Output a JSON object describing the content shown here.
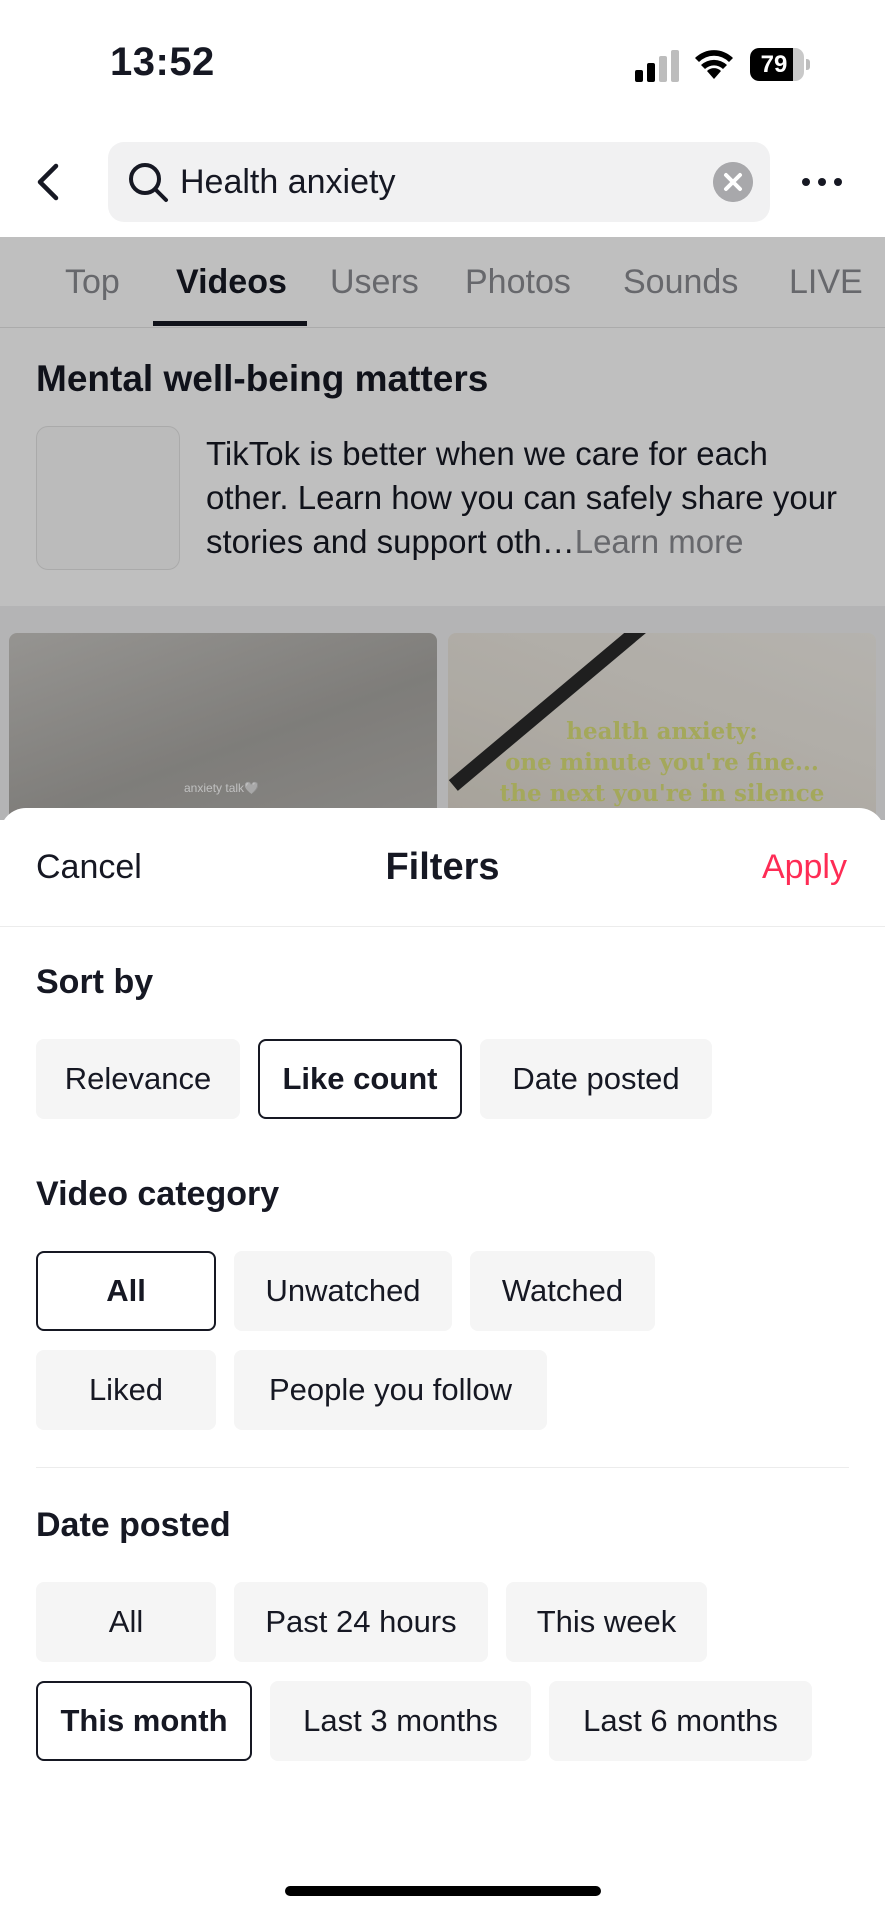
{
  "status_bar": {
    "time": "13:52",
    "battery": "79",
    "battery_level": 0.79
  },
  "search": {
    "query": "Health anxiety"
  },
  "tabs": [
    "Top",
    "Videos",
    "Users",
    "Photos",
    "Sounds",
    "LIVE"
  ],
  "wellbeing": {
    "title": "Mental well-being matters",
    "text": "TikTok is better when we care for each other. Learn how you can safely share your stories and support oth…",
    "link": "Learn more"
  },
  "videos": [
    {
      "caption": "anxiety talk🤍"
    },
    {
      "caption_lines": [
        "health anxiety:",
        "one minute you're fine...",
        "the next you're in silence"
      ]
    }
  ],
  "filters": {
    "cancel_label": "Cancel",
    "title": "Filters",
    "apply_label": "Apply",
    "sort_by": {
      "title": "Sort by",
      "options": [
        "Relevance",
        "Like count",
        "Date posted"
      ],
      "selected": "Like count"
    },
    "video_category": {
      "title": "Video category",
      "options": [
        "All",
        "Unwatched",
        "Watched",
        "Liked",
        "People you follow"
      ],
      "selected": "All"
    },
    "date_posted": {
      "title": "Date posted",
      "options": [
        "All",
        "Past 24 hours",
        "This week",
        "This month",
        "Last 3 months",
        "Last 6 months"
      ],
      "selected": "This month"
    }
  },
  "colors": {
    "accent": "#fe2c55",
    "text": "#161823",
    "muted": "#8a8b91",
    "chip_bg": "#f5f5f5"
  }
}
